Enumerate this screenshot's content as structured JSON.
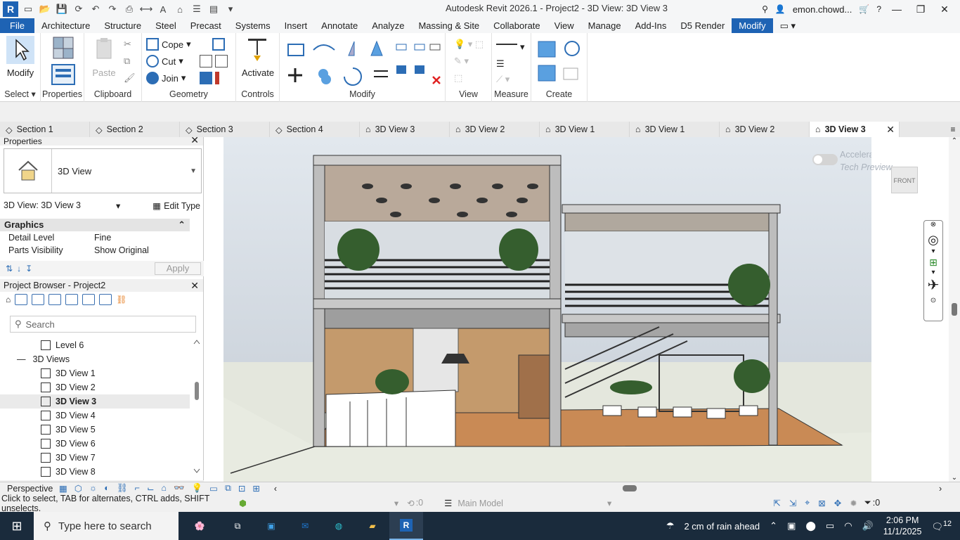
{
  "app": {
    "title": "Autodesk Revit 2026.1 - Project2 - 3D View: 3D View 3",
    "user": "emon.chowd..."
  },
  "ribbon_tabs": [
    "File",
    "Architecture",
    "Structure",
    "Steel",
    "Precast",
    "Systems",
    "Insert",
    "Annotate",
    "Analyze",
    "Massing & Site",
    "Collaborate",
    "View",
    "Manage",
    "Add-Ins",
    "D5 Render",
    "Modify"
  ],
  "ribbon": {
    "select": {
      "modify_label": "Modify",
      "panel": "Select"
    },
    "properties": {
      "panel": "Properties"
    },
    "clipboard": {
      "paste_label": "Paste",
      "panel": "Clipboard"
    },
    "geometry": {
      "cope": "Cope",
      "cut": "Cut",
      "join": "Join",
      "panel": "Geometry"
    },
    "controls": {
      "activate": "Activate",
      "panel": "Controls"
    },
    "modify": {
      "panel": "Modify"
    },
    "view": {
      "panel": "View"
    },
    "measure": {
      "panel": "Measure"
    },
    "create": {
      "panel": "Create"
    }
  },
  "view_tabs": [
    "Section 1",
    "Section 2",
    "Section 3",
    "Section 4",
    "3D View 3",
    "3D View 2",
    "3D View 1",
    "3D View 1",
    "3D View 2",
    "3D View 3"
  ],
  "properties": {
    "title": "Properties",
    "type_name": "3D View",
    "type_selector": "3D View: 3D View 3",
    "edit_type": "Edit Type",
    "group": "Graphics",
    "rows": [
      {
        "key": "Detail Level",
        "value": "Fine"
      },
      {
        "key": "Parts Visibility",
        "value": "Show Original"
      }
    ],
    "apply": "Apply"
  },
  "browser": {
    "title": "Project Browser - Project2",
    "search_placeholder": "Search",
    "level_item": "Level 6",
    "group": "3D Views",
    "views": [
      "3D View 1",
      "3D View 2",
      "3D View 3",
      "3D View 4",
      "3D View 5",
      "3D View 6",
      "3D View 7",
      "3D View 8"
    ],
    "selected": "3D View 3"
  },
  "viewport": {
    "accel_label": "Accelerated Graphics",
    "accel_sub": "Tech Preview",
    "viewcube": "FRONT"
  },
  "view_control": {
    "projection": "Perspective"
  },
  "status": {
    "hint": "Click to select, TAB for alternates, CTRL adds, SHIFT unselects.",
    "coord": ":0",
    "model": "Main Model",
    "filter_count": ":0"
  },
  "taskbar": {
    "search_placeholder": "Type here to search",
    "weather": "2 cm of rain ahead",
    "time": "2:06 PM",
    "date": "11/1/2025",
    "notifications": "12"
  },
  "colors": {
    "accent": "#1e63b4",
    "sky": "#dfe6ec",
    "ground": "#e3e6dc"
  }
}
